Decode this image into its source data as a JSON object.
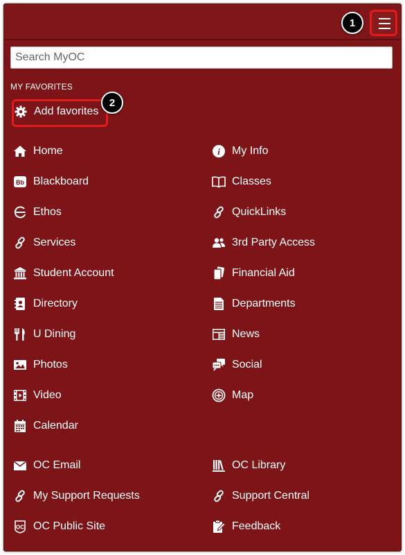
{
  "header": {
    "menu_label": "Menu"
  },
  "callouts": {
    "one": "1",
    "two": "2"
  },
  "search": {
    "placeholder": "Search MyOC",
    "value": ""
  },
  "favorites": {
    "title": "MY FAVORITES",
    "add_label": "Add favorites"
  },
  "menu": {
    "left": [
      {
        "label": "Home",
        "icon": "home-icon"
      },
      {
        "label": "Blackboard",
        "icon": "blackboard-icon"
      },
      {
        "label": "Ethos",
        "icon": "ethos-icon"
      },
      {
        "label": "Services",
        "icon": "link-icon"
      },
      {
        "label": "Student Account",
        "icon": "bank-icon"
      },
      {
        "label": "Directory",
        "icon": "address-book-icon"
      },
      {
        "label": "U Dining",
        "icon": "utensils-icon"
      },
      {
        "label": "Photos",
        "icon": "image-icon"
      },
      {
        "label": "Video",
        "icon": "film-icon"
      },
      {
        "label": "Calendar",
        "icon": "calendar-icon"
      }
    ],
    "right": [
      {
        "label": "My Info",
        "icon": "info-icon"
      },
      {
        "label": "Classes",
        "icon": "book-icon"
      },
      {
        "label": "QuickLinks",
        "icon": "link-icon"
      },
      {
        "label": "3rd Party Access",
        "icon": "users-icon"
      },
      {
        "label": "Financial Aid",
        "icon": "cards-icon"
      },
      {
        "label": "Departments",
        "icon": "document-icon"
      },
      {
        "label": "News",
        "icon": "newspaper-icon"
      },
      {
        "label": "Social",
        "icon": "chat-icon"
      },
      {
        "label": "Map",
        "icon": "compass-icon"
      }
    ]
  },
  "bottom_menu": {
    "left": [
      {
        "label": "OC Email",
        "icon": "envelope-icon"
      },
      {
        "label": "My Support Requests",
        "icon": "link-icon"
      },
      {
        "label": "OC Public Site",
        "icon": "oc-logo-icon"
      }
    ],
    "right": [
      {
        "label": "OC Library",
        "icon": "library-icon"
      },
      {
        "label": "Support Central",
        "icon": "link-icon"
      },
      {
        "label": "Feedback",
        "icon": "feedback-icon"
      }
    ]
  },
  "colors": {
    "background": "#7d1518",
    "highlight": "#e21b1b",
    "text": "#ffffff"
  }
}
